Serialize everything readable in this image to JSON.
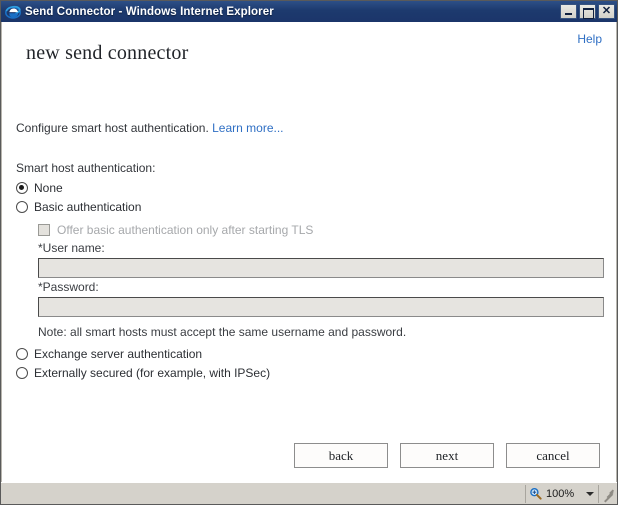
{
  "window": {
    "title": "Send Connector - Windows Internet Explorer",
    "icon": "internet-explorer-icon",
    "minimize_label": "",
    "maximize_label": "",
    "close_label": "✕"
  },
  "page": {
    "help_label": "Help",
    "wizard_title": "new send connector",
    "intro_text": "Configure smart host authentication.",
    "learn_more_label": "Learn more..."
  },
  "form": {
    "section_label": "Smart host authentication:",
    "options": [
      {
        "label": "None",
        "selected": true
      },
      {
        "label": "Basic authentication",
        "selected": false
      },
      {
        "label": "Exchange server authentication",
        "selected": false
      },
      {
        "label": "Externally secured (for example, with IPSec)",
        "selected": false
      }
    ],
    "basic_options": {
      "offer_tls_label": "Offer basic authentication only after starting TLS",
      "offer_tls_checked": false,
      "offer_tls_disabled": true,
      "username_label": "*User name:",
      "username_value": "",
      "username_disabled": true,
      "password_label": "*Password:",
      "password_value": "",
      "password_disabled": true,
      "note": "Note: all smart hosts must accept the same username and password."
    }
  },
  "buttons": {
    "back_label": "back",
    "next_label": "next",
    "cancel_label": "cancel"
  },
  "statusbar": {
    "left_text": "",
    "zoom_icon": "magnifier-icon",
    "zoom_level": "100%"
  },
  "colors": {
    "titlebar": "#1d3a6e",
    "link": "#2f6fc4",
    "disabled_text": "#a6a8ab",
    "body_text": "#33363b",
    "status_bg": "#d5d2cb"
  }
}
